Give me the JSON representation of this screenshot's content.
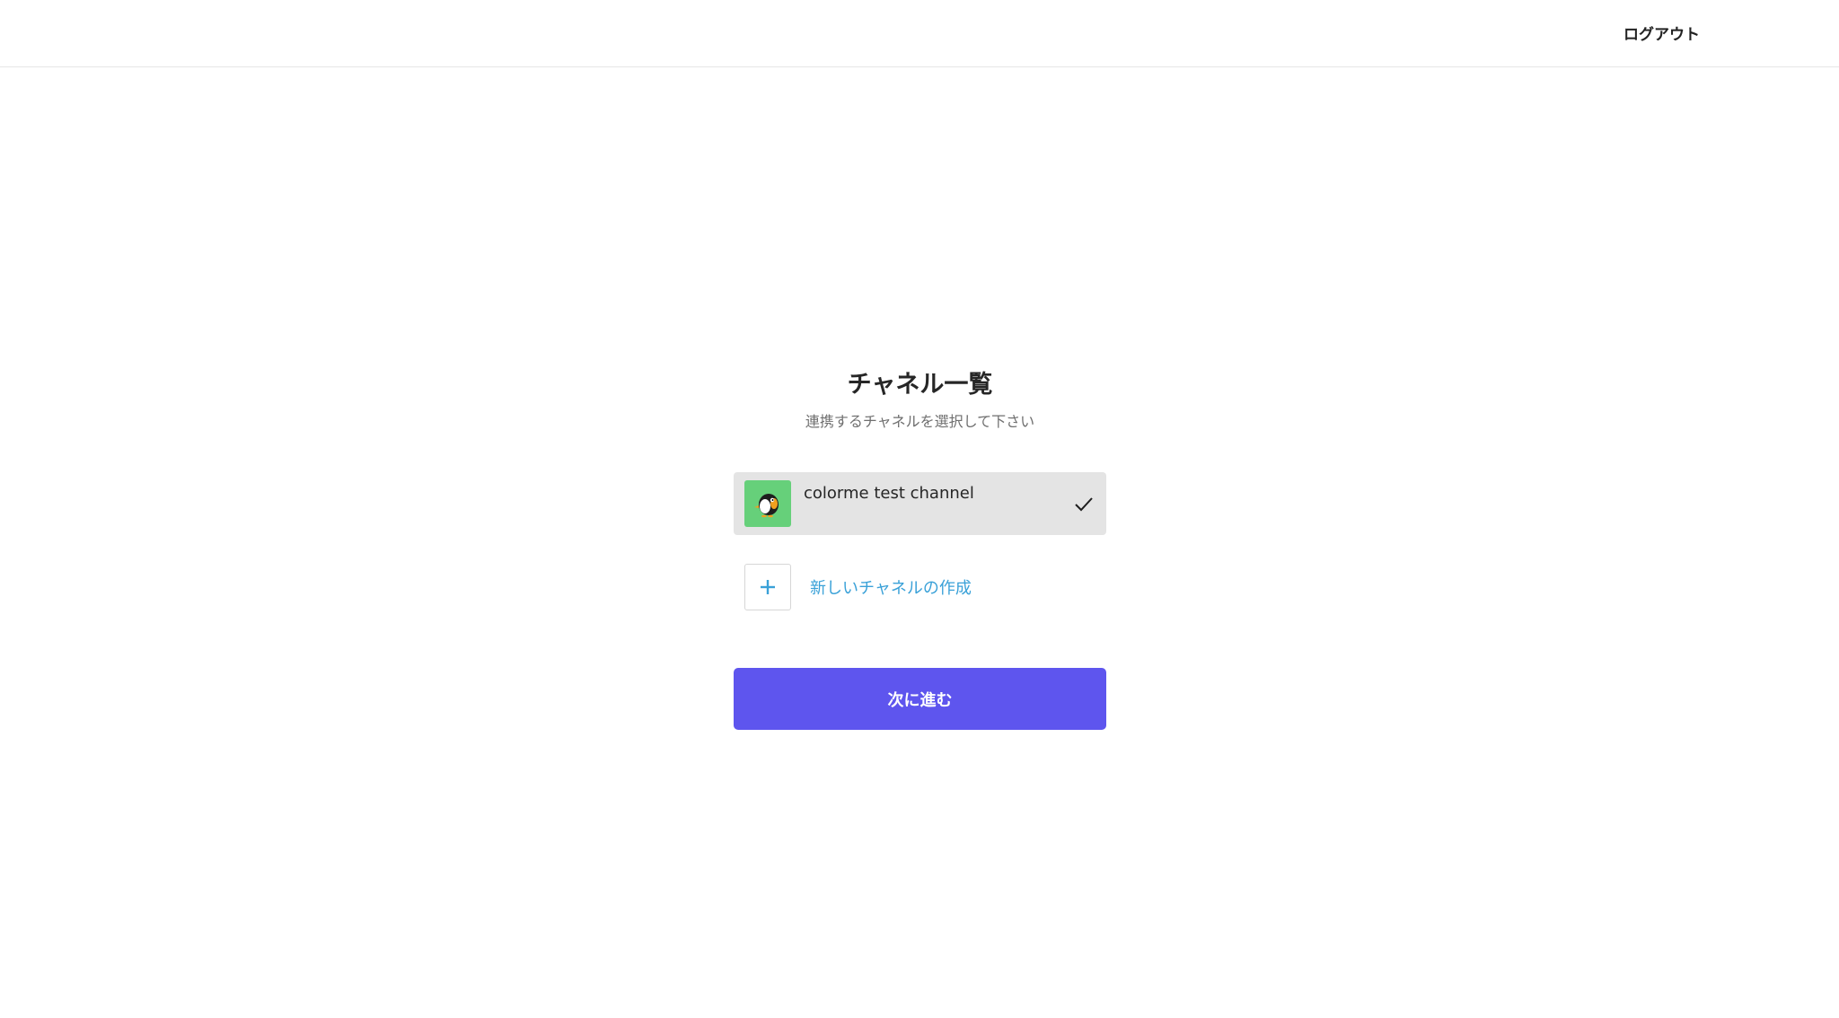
{
  "header": {
    "logout_label": "ログアウト"
  },
  "main": {
    "title": "チャネル一覧",
    "subtitle": "連携するチャネルを選択して下さい",
    "channels": [
      {
        "name": "colorme test channel",
        "avatar_icon": "penguin-icon",
        "avatar_color": "#66d07a",
        "selected": true
      }
    ],
    "new_channel_label": "新しいチャネルの作成",
    "next_button_label": "次に進む"
  },
  "colors": {
    "accent": "#5e55ee",
    "link": "#3aa1d8",
    "selected_bg": "#e4e4e4"
  }
}
